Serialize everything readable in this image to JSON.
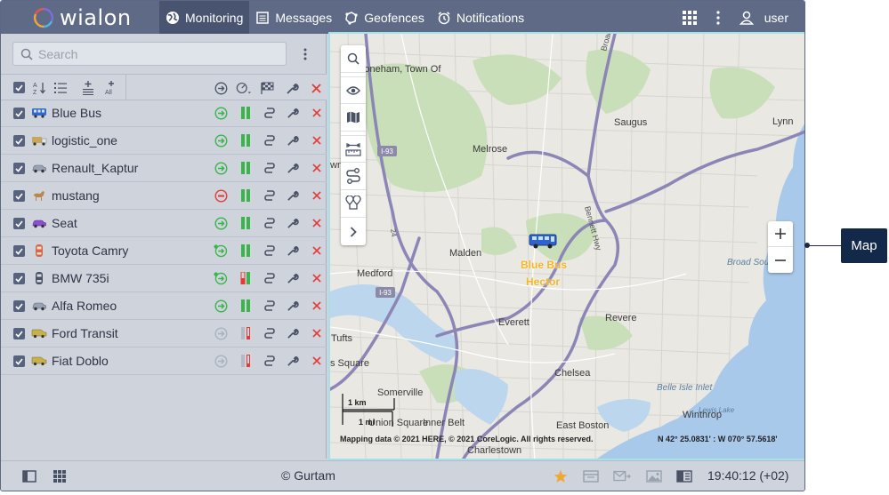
{
  "app": {
    "logo_text": "wialon"
  },
  "nav": [
    {
      "label": "Monitoring",
      "icon": "globe-icon",
      "active": true
    },
    {
      "label": "Messages",
      "icon": "messages-icon"
    },
    {
      "label": "Geofences",
      "icon": "geofence-icon"
    },
    {
      "label": "Notifications",
      "icon": "alarm-clock-icon"
    }
  ],
  "header_right": {
    "user": "user"
  },
  "search": {
    "placeholder": "Search"
  },
  "units": [
    {
      "name": "Blue Bus",
      "icon": "bus-icon",
      "status": "moving",
      "ignition": "on"
    },
    {
      "name": "logistic_one",
      "icon": "truck-icon",
      "status": "moving",
      "ignition": "on"
    },
    {
      "name": "Renault_Kaptur",
      "icon": "car-icon",
      "status": "moving",
      "ignition": "on"
    },
    {
      "name": "mustang",
      "icon": "horse-icon",
      "status": "stopped",
      "ignition": "on"
    },
    {
      "name": "Seat",
      "icon": "car-icon",
      "status": "moving",
      "ignition": "on"
    },
    {
      "name": "Toyota Camry",
      "icon": "car-top-icon",
      "status": "moving-alert",
      "ignition": "on"
    },
    {
      "name": "BMW 735i",
      "icon": "car-top-icon",
      "status": "moving-alert",
      "ignition": "partial"
    },
    {
      "name": "Alfa Romeo",
      "icon": "car-icon",
      "status": "moving",
      "ignition": "on"
    },
    {
      "name": "Ford Transit",
      "icon": "van-icon",
      "status": "inactive",
      "ignition": "off"
    },
    {
      "name": "Fiat Doblo",
      "icon": "van-icon",
      "status": "inactive",
      "ignition": "off"
    }
  ],
  "map": {
    "towns": [
      "Stoneham, Town Of",
      "Melrose",
      "Saugus",
      "Lynn",
      "Malden",
      "Medford",
      "Revere",
      "Everett",
      "Tufts",
      "Chelsea",
      "Somerville",
      "Union Square",
      "Inner Belt",
      "East Boston",
      "Winthrop",
      "Charlestown",
      "s Square",
      "wn"
    ],
    "water": [
      "Broad Sou",
      "Belle Isle Inlet",
      "Lewis Lake"
    ],
    "roads": [
      "I-93",
      "I-93",
      "Broad",
      "Bennett Hwy",
      "24"
    ],
    "unit_labels": [
      "Blue Bus",
      "Hector"
    ],
    "copyright": "Mapping data © 2021 HERE, © 2021 CoreLogic. All rights reserved.",
    "coords": "N 42° 25.0831' : W 070° 57.5618'",
    "scale": [
      "1 km",
      "1 mi"
    ]
  },
  "footer": {
    "copyright": "© Gurtam",
    "time": "19:40:12 (+02)"
  },
  "callout": {
    "label": "Map"
  },
  "colors": {
    "header": "#5f6a86",
    "panel": "#ced3dc",
    "green": "#39b54a",
    "red": "#e53935",
    "callout": "#12294a"
  }
}
